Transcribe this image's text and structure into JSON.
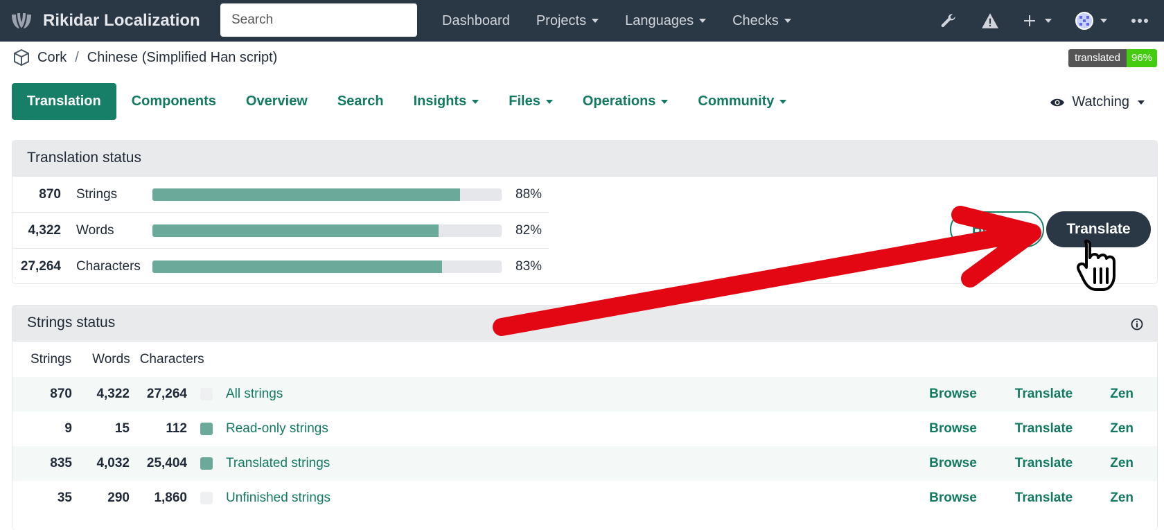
{
  "navbar": {
    "brand": "Rikidar Localization",
    "search_placeholder": "Search",
    "links": [
      {
        "label": "Dashboard",
        "dropdown": false
      },
      {
        "label": "Projects",
        "dropdown": true
      },
      {
        "label": "Languages",
        "dropdown": true
      },
      {
        "label": "Checks",
        "dropdown": true
      }
    ],
    "icons": [
      "wrench-icon",
      "warning-icon",
      "plus-icon",
      "avatar",
      "more-icon"
    ]
  },
  "breadcrumb": {
    "project": "Cork",
    "separator": "/",
    "language": "Chinese (Simplified Han script)"
  },
  "badge": {
    "label": "translated",
    "value": "96%"
  },
  "tabs": [
    {
      "label": "Translation",
      "active": true,
      "dropdown": false
    },
    {
      "label": "Components",
      "dropdown": false
    },
    {
      "label": "Overview",
      "dropdown": false
    },
    {
      "label": "Search",
      "dropdown": false
    },
    {
      "label": "Insights",
      "dropdown": true
    },
    {
      "label": "Files",
      "dropdown": true
    },
    {
      "label": "Operations",
      "dropdown": true
    },
    {
      "label": "Community",
      "dropdown": true
    }
  ],
  "watching": "Watching",
  "translation_status": {
    "title": "Translation status",
    "rows": [
      {
        "count": "870",
        "label": "Strings",
        "percent": 88,
        "percent_label": "88%"
      },
      {
        "count": "4,322",
        "label": "Words",
        "percent": 82,
        "percent_label": "82%"
      },
      {
        "count": "27,264",
        "label": "Characters",
        "percent": 83,
        "percent_label": "83%"
      }
    ],
    "browse_label": "Browse",
    "translate_label": "Translate"
  },
  "strings_status": {
    "title": "Strings status",
    "headers": [
      "Strings",
      "Words",
      "Characters"
    ],
    "rows": [
      {
        "strings": "870",
        "words": "4,322",
        "chars": "27,264",
        "name": "All strings",
        "swatch": "#eef0f2"
      },
      {
        "strings": "9",
        "words": "15",
        "chars": "112",
        "name": "Read-only strings",
        "swatch": "#6ba99a"
      },
      {
        "strings": "835",
        "words": "4,032",
        "chars": "25,404",
        "name": "Translated strings",
        "swatch": "#6ba99a"
      },
      {
        "strings": "35",
        "words": "290",
        "chars": "1,860",
        "name": "Unfinished strings",
        "swatch": "#eef0f2"
      }
    ],
    "actions": [
      "Browse",
      "Translate",
      "Zen"
    ]
  },
  "colors": {
    "navbar": "#2a3744",
    "accent": "#177e68",
    "bar": "#6ba99a",
    "arrow": "#e30613"
  }
}
